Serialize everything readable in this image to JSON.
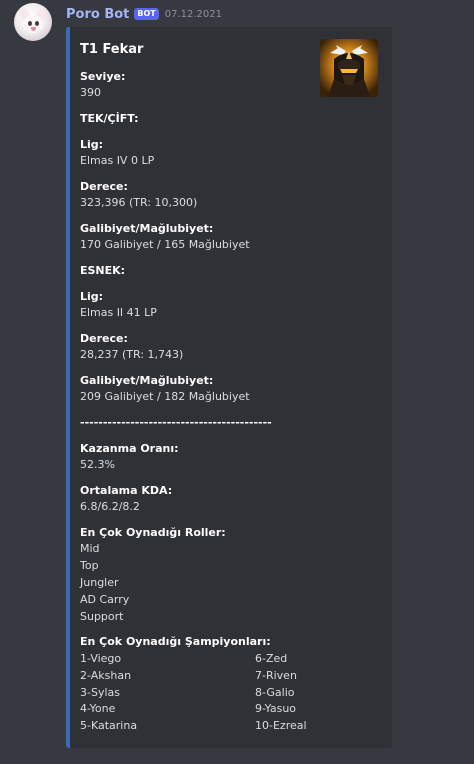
{
  "message": {
    "username": "Poro Bot",
    "bot_tag": "BOT",
    "timestamp": "07.12.2021",
    "avatar": "poro-avatar-icon"
  },
  "embed": {
    "accent_color": "#3b6ab8",
    "thumbnail": "champion-helmet-icon",
    "title": "T1 Fekar",
    "level_label": "Seviye:",
    "level_value": "390",
    "solo_heading": "TEK/ÇİFT:",
    "solo_league_label": "Lig:",
    "solo_league_value": "Elmas IV 0 LP",
    "solo_rank_label": "Derece:",
    "solo_rank_value": "323,396 (TR: 10,300)",
    "solo_wl_label": "Galibiyet/Mağlubiyet:",
    "solo_wl_value": "170 Galibiyet / 165 Mağlubiyet",
    "flex_heading": "ESNEK:",
    "flex_league_label": "Lig:",
    "flex_league_value": "Elmas II 41 LP",
    "flex_rank_label": "Derece:",
    "flex_rank_value": "28,237 (TR: 1,743)",
    "flex_wl_label": "Galibiyet/Mağlubiyet:",
    "flex_wl_value": "209 Galibiyet / 182 Mağlubiyet",
    "separator": "------------------------------------------",
    "winrate_label": "Kazanma Oranı:",
    "winrate_value": "52.3%",
    "kda_label": "Ortalama KDA:",
    "kda_value": "6.8/6.2/8.2",
    "roles_label": "En Çok Oynadığı Roller:",
    "roles": [
      "Mid",
      "Top",
      "Jungler",
      "AD Carry",
      "Support"
    ],
    "champs_label": "En Çok Oynadığı Şampiyonları:",
    "champs_left": [
      "1-Viego",
      "2-Akshan",
      "3-Sylas",
      "4-Yone",
      "5-Katarina"
    ],
    "champs_right": [
      "6-Zed",
      "7-Riven",
      "8-Galio",
      "9-Yasuo",
      "10-Ezreal"
    ]
  }
}
